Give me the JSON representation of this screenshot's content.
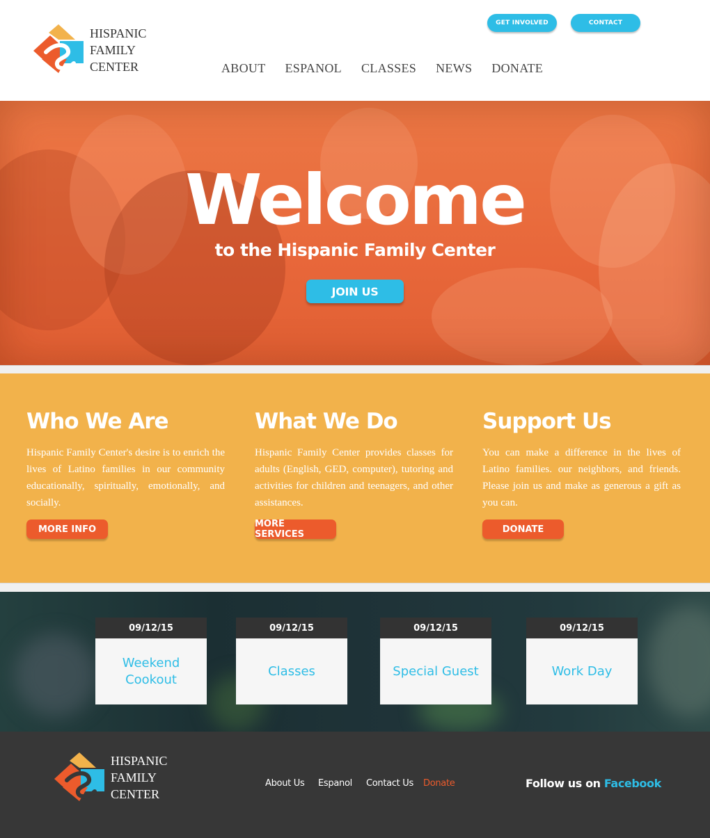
{
  "brand": {
    "name_line1": "HISPANIC",
    "name_line2": "FAMILY",
    "name_line3": "CENTER"
  },
  "header": {
    "get_involved": "GET INVOLVED",
    "contact": "CONTACT",
    "nav": [
      "ABOUT",
      "ESPANOL",
      "CLASSES",
      "NEWS",
      "DONATE"
    ]
  },
  "hero": {
    "title": "Welcome",
    "subtitle": "to the Hispanic Family Center",
    "cta": "JOIN US"
  },
  "info": {
    "columns": [
      {
        "heading": "Who We Are",
        "text": "Hispanic Family Center's desire is to enrich the lives of Latino families in our community educationally, spiritually, emotionally, and socially.",
        "button": "MORE INFO"
      },
      {
        "heading": "What We Do",
        "text": "Hispanic Family Center provides classes for adults (English, GED, computer), tutoring and activities for children and teenagers, and other assistances.",
        "button": "MORE SERVICES"
      },
      {
        "heading": "Support Us",
        "text": "You can make a difference in the lives of Latino families. our neighbors, and friends. Please join us and make as generous a gift as you can.",
        "button": "DONATE"
      }
    ]
  },
  "events": [
    {
      "date": "09/12/15",
      "title": "Weekend Cookout"
    },
    {
      "date": "09/12/15",
      "title": "Classes"
    },
    {
      "date": "09/12/15",
      "title": "Special Guest"
    },
    {
      "date": "09/12/15",
      "title": "Work Day"
    }
  ],
  "footer": {
    "links": [
      "About Us",
      "Espanol",
      "Contact Us",
      "Donate"
    ],
    "follow_prefix": "Follow us on ",
    "follow_link": "Facebook"
  },
  "colors": {
    "accent_blue": "#2ebde6",
    "accent_orange": "#ec5b2c",
    "hero_orange": "#e8673a",
    "section_yellow": "#f2b24b",
    "footer_dark": "#373737"
  },
  "icons": {
    "logo": "hispanic-family-center-logo-icon"
  }
}
